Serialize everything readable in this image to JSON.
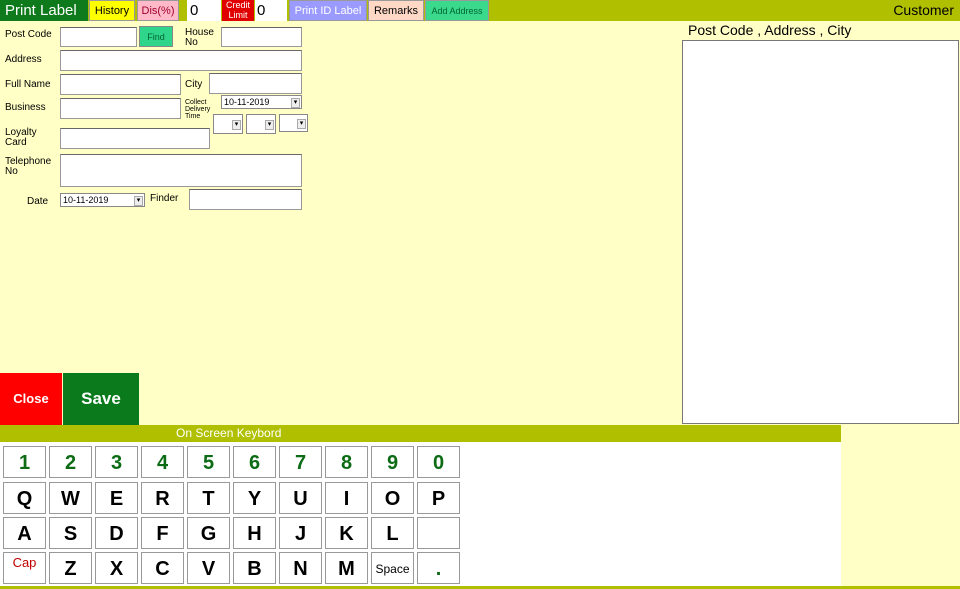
{
  "topbar": {
    "title": "Print Label",
    "history": "History",
    "discount": "Dis(%)",
    "discount_value": "0",
    "credit_limit": "Credit Limit",
    "credit_value": "0",
    "print_id_label": "Print ID Label",
    "remarks": "Remarks",
    "add_address": "Add Address",
    "customer": "Customer"
  },
  "form": {
    "post_code": "Post Code",
    "find": "Find",
    "house_no": "House No",
    "address": "Address",
    "full_name": "Full Name",
    "city": "City",
    "business": "Business",
    "collect_delivery_time": "Collect Delivery Time",
    "collect_date": "10-11-2019",
    "loyalty_card": "Loyalty Card",
    "telephone_no": "Telephone No",
    "date_label": "Date",
    "date_value": "10-11-2019",
    "finder": "Finder"
  },
  "right_panel": {
    "title": "Post Code , Address , City"
  },
  "actions": {
    "close": "Close",
    "save": "Save"
  },
  "keyboard": {
    "title": "On Screen Keybord",
    "row1": [
      "1",
      "2",
      "3",
      "4",
      "5",
      "6",
      "7",
      "8",
      "9",
      "0"
    ],
    "row2": [
      "Q",
      "W",
      "E",
      "R",
      "T",
      "Y",
      "U",
      "I",
      "O",
      "P"
    ],
    "row3": [
      "A",
      "S",
      "D",
      "F",
      "G",
      "H",
      "J",
      "K",
      "L",
      ""
    ],
    "row4": [
      "Cap",
      "Z",
      "X",
      "C",
      "V",
      "B",
      "N",
      "M",
      "Space",
      "."
    ]
  },
  "colors": {
    "bar": "#b0c000",
    "background": "#ffffc6",
    "title_green": "#0f7a1c",
    "close_red": "#ff0000",
    "save_green": "#0a7a1c"
  }
}
